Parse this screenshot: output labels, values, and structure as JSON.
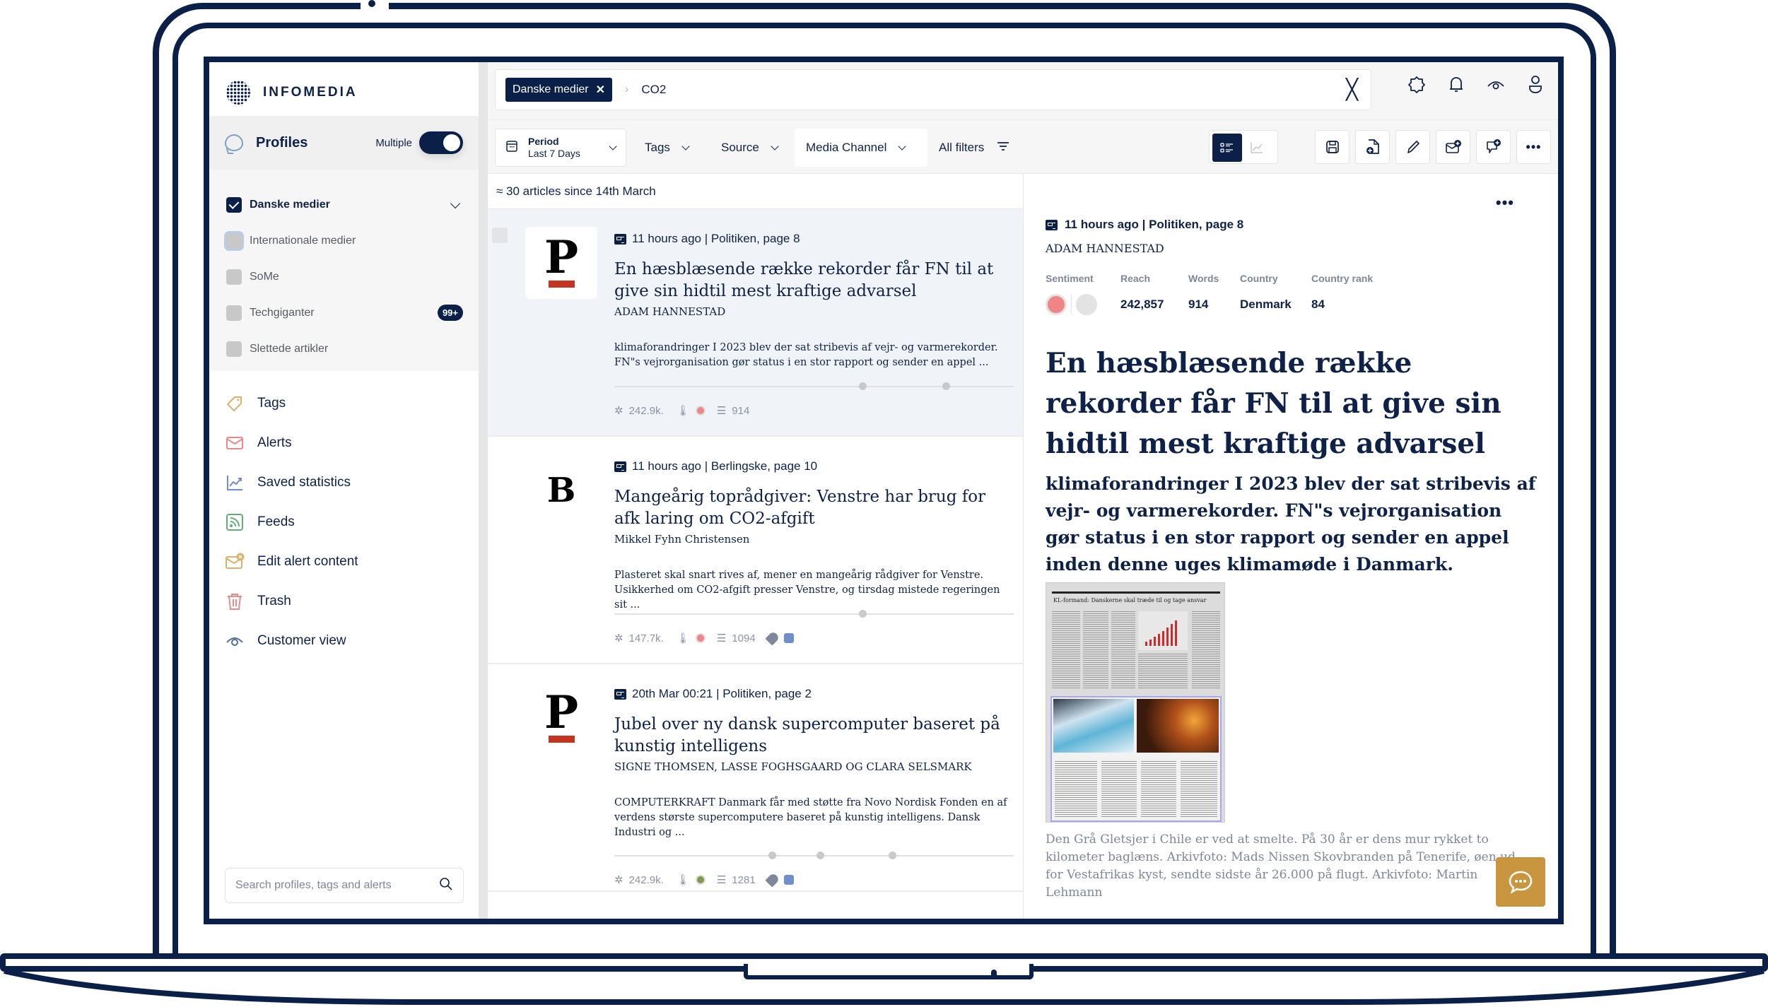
{
  "sidebar": {
    "logo_text": "INFOMEDIA",
    "profiles_title": "Profiles",
    "multiple_label": "Multiple",
    "multiple_enabled": true,
    "profiles": [
      {
        "label": "Danske medier",
        "checked": true
      },
      {
        "label": "Internationale medier",
        "checked": false
      },
      {
        "label": "SoMe",
        "checked": false
      },
      {
        "label": "Techgiganter",
        "checked": false,
        "badge": "99+"
      },
      {
        "label": "Slettede artikler",
        "checked": false
      }
    ],
    "nav": [
      {
        "label": "Tags",
        "icon": "tag-icon",
        "color": "#d9b36a"
      },
      {
        "label": "Alerts",
        "icon": "mail-icon",
        "color": "#e88a8a"
      },
      {
        "label": "Saved statistics",
        "icon": "chart-line-icon",
        "color": "#6f8fcc"
      },
      {
        "label": "Feeds",
        "icon": "rss-icon",
        "color": "#5fae74"
      },
      {
        "label": "Edit alert content",
        "icon": "mail-edit-icon",
        "color": "#d9b36a"
      },
      {
        "label": "Trash",
        "icon": "trash-icon",
        "color": "#e88a8a"
      },
      {
        "label": "Customer view",
        "icon": "eye-icon",
        "color": "#4f6f96"
      }
    ],
    "search_placeholder": "Search profiles, tags and alerts"
  },
  "topbar": {
    "chip_label": "Danske medier",
    "query": "CO2"
  },
  "filters": {
    "period_label": "Period",
    "period_value": "Last 7 Days",
    "tags": "Tags",
    "source": "Source",
    "media_channel": "Media Channel",
    "all_filters": "All filters"
  },
  "list": {
    "count_text": "≈ 30 articles since 14th March",
    "articles": [
      {
        "publication": "Politiken",
        "meta": "11 hours ago | Politiken, page 8",
        "title": "En hæsblæsende række rekorder får FN til at give sin hidtil mest kraftige advarsel",
        "author": "ADAM HANNESTAD",
        "excerpt": "klimaforandringer I 2023 blev der sat stribevis af vejr- og varmerekorder. FN\"s vejrorganisation gør status i en stor rapport og sender en appel ...",
        "reach": "242.9k.",
        "sentiment_color": "#ef8585",
        "words": "914",
        "has_tags": false
      },
      {
        "publication": "Berlingske",
        "meta": "11 hours ago | Berlingske, page 10",
        "title": "Mangeårig toprådgiver: Venstre har brug for afk laring om CO2-afgift",
        "author": "Mikkel Fyhn Christensen",
        "excerpt": "Plasteret skal snart rives af, mener en mangeårig rådgiver for Venstre. Usikkerhed om CO2-afgift presser Venstre, og tirsdag mistede regeringen sit ...",
        "reach": "147.7k.",
        "sentiment_color": "#ef8585",
        "words": "1094",
        "has_tags": true
      },
      {
        "publication": "Politiken",
        "meta": "20th Mar 00:21 | Politiken, page 2",
        "title": "Jubel over ny dansk supercomputer baseret på kunstig intelligens",
        "author": "SIGNE THOMSEN, LASSE FOGHSGAARD OG CLARA SELSMARK",
        "excerpt": "COMPUTERKRAFT Danmark får med støtte fra Novo Nordisk Fonden en af verdens største supercomputere baseret på kunstig intelligens. Dansk Industri og ...",
        "reach": "242.9k.",
        "sentiment_color": "#7f9a4e",
        "words": "1281",
        "has_tags": true
      }
    ]
  },
  "detail": {
    "meta": "11 hours ago | Politiken, page 8",
    "author": "ADAM HANNESTAD",
    "stats_headers": [
      "Sentiment",
      "Reach",
      "Words",
      "Country",
      "Country rank"
    ],
    "reach": "242,857",
    "words": "914",
    "country": "Denmark",
    "country_rank": "84",
    "sentiment_color": "#ef8585",
    "headline": "En hæsblæsende række rekorder får FN til at give sin hidtil mest kraftige advarsel",
    "lead": "klimaforandringer I 2023 blev der sat stribevis af vejr- og varmerekorder. FN\"s vejrorganisation gør status i en stor rapport og sender en appel inden denne uges klimamøde i Danmark.",
    "page_headline": "KL-formand: Danskerne skal træde til og tage ansvar",
    "caption": "Den Grå Gletsjer i Chile er ved at smelte. På 30 år er dens mur rykket to kilometer baglæns. Arkivfoto: Mads Nissen Skovbranden på Tenerife, øen ud for Vestafrikas kyst, sendte sidste år 26.000 på flugt. Arkivfoto: Martin Lehmann"
  },
  "colors": {
    "navy": "#0a2048",
    "accent_gold": "#c9963f",
    "politiken_red": "#c4341f"
  }
}
